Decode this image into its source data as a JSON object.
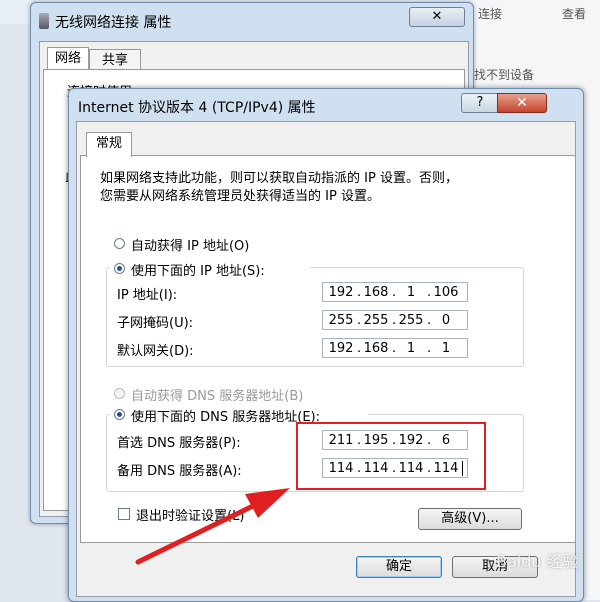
{
  "background": {
    "top_items": [
      "连接",
      "查看"
    ],
    "side_text": "找不到设备"
  },
  "win1": {
    "title": "无线网络连接 属性",
    "close_glyph": "✕",
    "tabs": [
      "网络",
      "共享"
    ],
    "partial_label": "连接时使用:",
    "partial_label2": "此"
  },
  "win2": {
    "title": "Internet 协议版本 4 (TCP/IPv4) 属性",
    "help_glyph": "?",
    "close_glyph": "✕",
    "tab": "常规",
    "description_line1": "如果网络支持此功能，则可以获取自动指派的 IP 设置。否则，",
    "description_line2": "您需要从网络系统管理员处获得适当的 IP 设置。",
    "auto_ip_label": "自动获得 IP 地址(O)",
    "manual_ip_label": "使用下面的 IP 地址(S):",
    "ip_label": "IP 地址(I):",
    "ip_value": [
      "192",
      "168",
      "1",
      "106"
    ],
    "mask_label": "子网掩码(U):",
    "mask_value": [
      "255",
      "255",
      "255",
      "0"
    ],
    "gateway_label": "默认网关(D):",
    "gateway_value": [
      "192",
      "168",
      "1",
      "1"
    ],
    "auto_dns_label": "自动获得 DNS 服务器地址(B)",
    "manual_dns_label": "使用下面的 DNS 服务器地址(E):",
    "dns1_label": "首选 DNS 服务器(P):",
    "dns1_value": [
      "211",
      "195",
      "192",
      "6"
    ],
    "dns2_label": "备用 DNS 服务器(A):",
    "dns2_value": [
      "114",
      "114",
      "114",
      "114"
    ],
    "validate_label": "退出时验证设置(L)",
    "advanced_label": "高级(V)...",
    "ok_label": "确定",
    "cancel_label": "取消"
  },
  "annotation": {
    "box_color": "#e02020",
    "arrow_color": "#e02020"
  },
  "watermark": "Baidu 经验"
}
